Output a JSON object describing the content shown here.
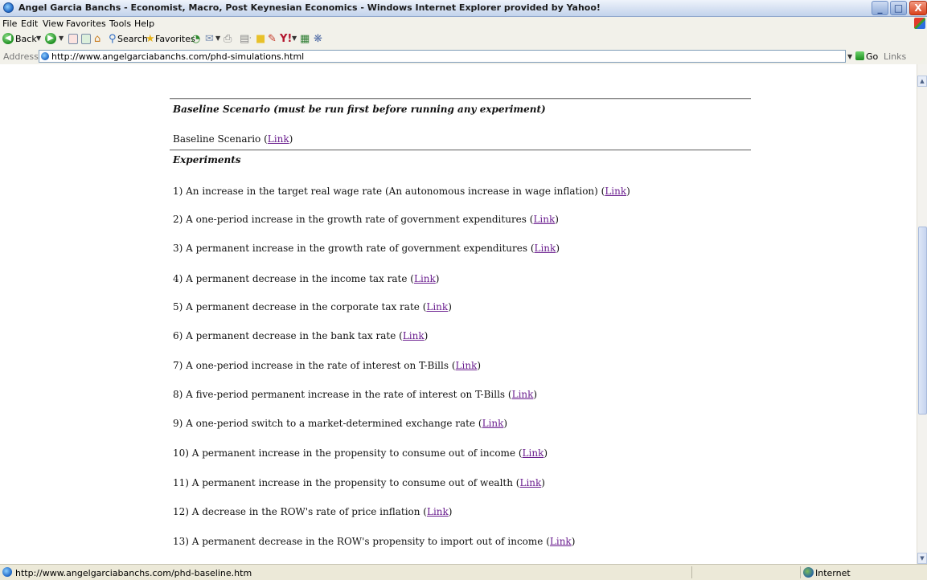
{
  "window": {
    "title": "Angel Garcia Banchs - Economist, Macro, Post Keynesian Economics - Windows Internet Explorer provided by Yahoo!",
    "min_label": "_",
    "max_label": "□",
    "close_label": "X"
  },
  "menu": [
    "File",
    "Edit",
    "View",
    "Favorites",
    "Tools",
    "Help"
  ],
  "toolbar": {
    "back_label": "Back",
    "search_label": "Search",
    "favorites_label": "Favorites"
  },
  "address": {
    "label": "Address",
    "url": "http://www.angelgarciabanchs.com/phd-simulations.html",
    "go_label": "Go",
    "links_label": "Links"
  },
  "page": {
    "baseline_heading": "Baseline Scenario (must be run first before running any experiment)",
    "baseline_text": "Baseline Scenario",
    "experiments_heading": "Experiments",
    "link_label": "Link",
    "experiments": [
      "1) An increase in the target real wage rate (An autonomous increase in wage inflation)",
      "2) A one-period increase in the growth rate of government expenditures",
      "3) A permanent increase in the growth rate of government expenditures",
      "4) A permanent decrease in the income tax rate",
      "5) A permanent decrease in the corporate tax rate",
      "6) A permanent decrease in the bank tax rate",
      "7) A one-period increase in the rate of interest on T-Bills",
      "8) A five-period permanent increase in the rate of interest on T-Bills",
      "9) A one-period switch to a market-determined exchange rate",
      "10) A permanent increase in the propensity to consume out of income",
      "11) A permanent increase in the propensity to consume out of wealth",
      "12) A decrease in the ROW's rate of price inflation",
      "13) A permanent decrease in the ROW's propensity to import out of income"
    ]
  },
  "status": {
    "text": "http://www.angelgarciabanchs.com/phd-baseline.htm",
    "zone": "Internet"
  },
  "colors": {
    "link": "#6b1f8f",
    "titlebar": "#d6e1f2"
  }
}
